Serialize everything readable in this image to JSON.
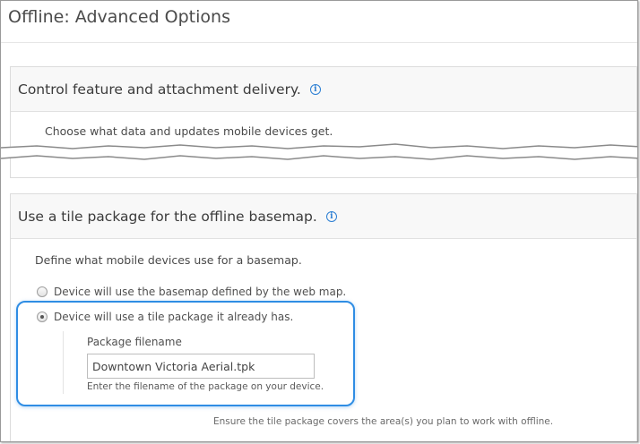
{
  "window": {
    "title": "Offline: Advanced Options"
  },
  "section_features": {
    "title": "Control feature and attachment delivery.",
    "info_icon": "info-icon",
    "description": "Choose what data and updates mobile devices get."
  },
  "section_basemap": {
    "title": "Use a tile package for the offline basemap.",
    "info_icon": "info-icon",
    "description": "Define what mobile devices use for a basemap.",
    "options": [
      {
        "label": "Device will use the basemap defined by the web map.",
        "selected": false
      },
      {
        "label": "Device will use a tile package it already has.",
        "selected": true
      }
    ],
    "package_field": {
      "label": "Package filename",
      "value": "Downtown Victoria Aerial.tpk",
      "hint": "Enter the filename of the package on your device."
    },
    "footer_note": "Ensure the tile package covers the area(s) you plan to work with offline."
  },
  "colors": {
    "accent": "#2f8de4",
    "info": "#2b7ed3",
    "header_bg": "#f8f8f8"
  }
}
